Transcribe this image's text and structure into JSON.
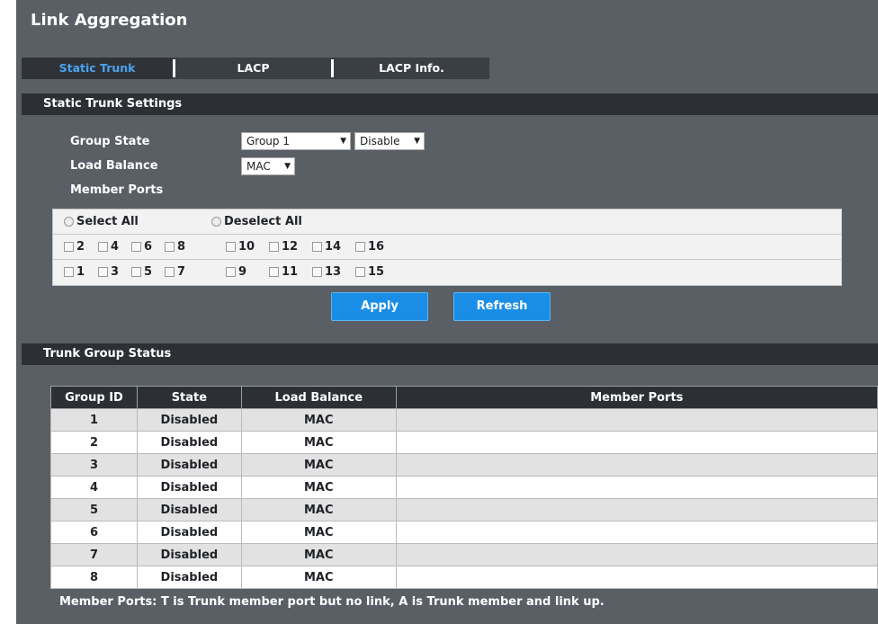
{
  "page": {
    "title": "Link Aggregation"
  },
  "tabs": [
    {
      "label": "Static Trunk",
      "active": true
    },
    {
      "label": "LACP",
      "active": false
    },
    {
      "label": "LACP Info.",
      "active": false
    }
  ],
  "settings": {
    "section_title": "Static Trunk Settings",
    "group_state_label": "Group State",
    "group_value": "Group 1",
    "state_value": "Disable",
    "load_balance_label": "Load Balance",
    "load_balance_value": "MAC",
    "member_ports_label": "Member Ports",
    "select_all_label": "Select All",
    "deselect_all_label": "Deselect All",
    "even_ports": [
      "2",
      "4",
      "6",
      "8",
      "10",
      "12",
      "14",
      "16"
    ],
    "odd_ports": [
      "1",
      "3",
      "5",
      "7",
      "9",
      "11",
      "13",
      "15"
    ],
    "apply_label": "Apply",
    "refresh_label": "Refresh"
  },
  "status": {
    "section_title": "Trunk Group Status",
    "columns": [
      "Group ID",
      "State",
      "Load Balance",
      "Member Ports"
    ],
    "rows": [
      {
        "id": "1",
        "state": "Disabled",
        "balance": "MAC",
        "members": ""
      },
      {
        "id": "2",
        "state": "Disabled",
        "balance": "MAC",
        "members": ""
      },
      {
        "id": "3",
        "state": "Disabled",
        "balance": "MAC",
        "members": ""
      },
      {
        "id": "4",
        "state": "Disabled",
        "balance": "MAC",
        "members": ""
      },
      {
        "id": "5",
        "state": "Disabled",
        "balance": "MAC",
        "members": ""
      },
      {
        "id": "6",
        "state": "Disabled",
        "balance": "MAC",
        "members": ""
      },
      {
        "id": "7",
        "state": "Disabled",
        "balance": "MAC",
        "members": ""
      },
      {
        "id": "8",
        "state": "Disabled",
        "balance": "MAC",
        "members": ""
      }
    ],
    "footnote": "Member Ports: T is Trunk member port but no link, A is Trunk member and link up."
  },
  "colors": {
    "panel_bg": "#595f65",
    "header_bar": "#2c3035",
    "active_tab_text": "#4aa3f0",
    "button_bg": "#1a8ee6"
  }
}
